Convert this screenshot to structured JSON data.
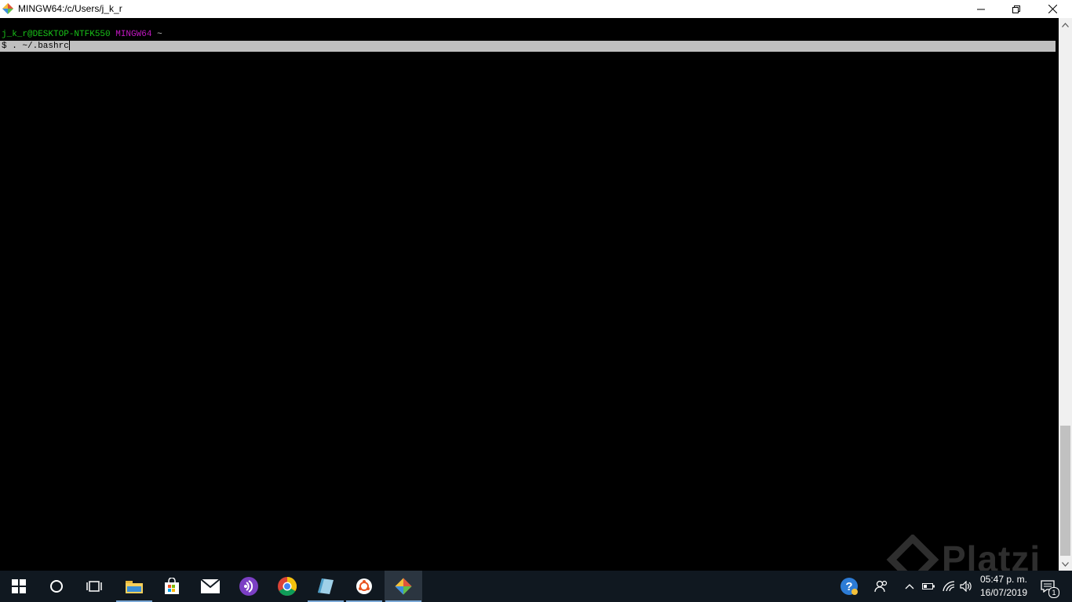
{
  "window": {
    "title": "MINGW64:/c/Users/j_k_r"
  },
  "terminal": {
    "prompt_user": "j_k_r@DESKTOP-NTFK550",
    "prompt_system": "MINGW64",
    "prompt_path": "~",
    "command_line": "$ . ~/.bashrc"
  },
  "taskbar": {
    "apps": [
      {
        "name": "start-button",
        "icon": "windows-logo-icon"
      },
      {
        "name": "cortana-button",
        "icon": "search-circle-icon"
      },
      {
        "name": "task-view-button",
        "icon": "task-view-icon"
      },
      {
        "name": "file-explorer",
        "icon": "folder-icon"
      },
      {
        "name": "microsoft-store",
        "icon": "store-bag-icon"
      },
      {
        "name": "mail",
        "icon": "envelope-icon"
      },
      {
        "name": "purple-app",
        "icon": "podcast-icon"
      },
      {
        "name": "chrome",
        "icon": "chrome-icon"
      },
      {
        "name": "notebook-app",
        "icon": "notebook-icon"
      },
      {
        "name": "ubuntu",
        "icon": "ubuntu-icon"
      },
      {
        "name": "git-bash",
        "icon": "git-icon"
      }
    ],
    "clock_time": "05:47 p. m.",
    "clock_date": "16/07/2019",
    "notification_count": "1"
  },
  "watermark_text": "Platzi",
  "colors": {
    "prompt_user": "#18c218",
    "prompt_system": "#c218c2",
    "selection": "#c0c0c0",
    "taskbar": "#101820",
    "active_app_underline": "#7aa8d6"
  }
}
